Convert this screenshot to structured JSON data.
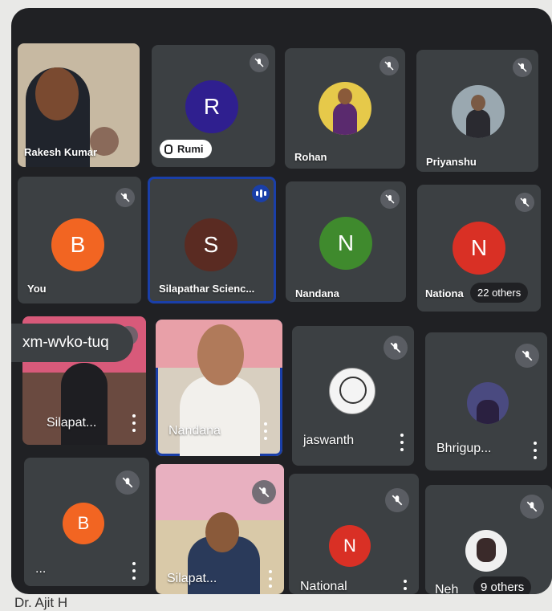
{
  "meeting_code": "xm-wvko-tuq",
  "overflow_tiles": [
    {
      "prefix": "Nationa",
      "others": "22 others"
    },
    {
      "prefix": "Neh",
      "others": "9 others"
    }
  ],
  "participants": [
    {
      "name": "Rakesh Kumar",
      "type": "video"
    },
    {
      "name": "Rumi",
      "initial": "R",
      "color": "#2f1f8f",
      "muted": true,
      "chip": true
    },
    {
      "name": "Rohan",
      "type": "photo",
      "muted": true
    },
    {
      "name": "Priyanshu",
      "type": "photo",
      "muted": true
    },
    {
      "name": "You",
      "initial": "B",
      "color": "#f26522",
      "muted": true
    },
    {
      "name": "Silapathar Scienc...",
      "initial": "S",
      "color": "#5a2b22",
      "speaking": true
    },
    {
      "name": "Nandana",
      "initial": "N",
      "color": "#3f8a2d",
      "muted": true
    },
    {
      "name": "Silapat...",
      "type": "video",
      "muted": true
    },
    {
      "name": "Nandana",
      "type": "video"
    },
    {
      "name": "jaswanth",
      "type": "photo",
      "muted": true
    },
    {
      "name": "Bhrigup...",
      "type": "photo",
      "muted": true
    },
    {
      "name": "...",
      "initial": "B",
      "color": "#f26522",
      "muted": true
    },
    {
      "name": "Silapat...",
      "type": "video",
      "muted": true
    },
    {
      "name": "National",
      "initial": "N",
      "color": "#d93025",
      "muted": true
    }
  ],
  "caption_text": "Dr. Ajit H"
}
